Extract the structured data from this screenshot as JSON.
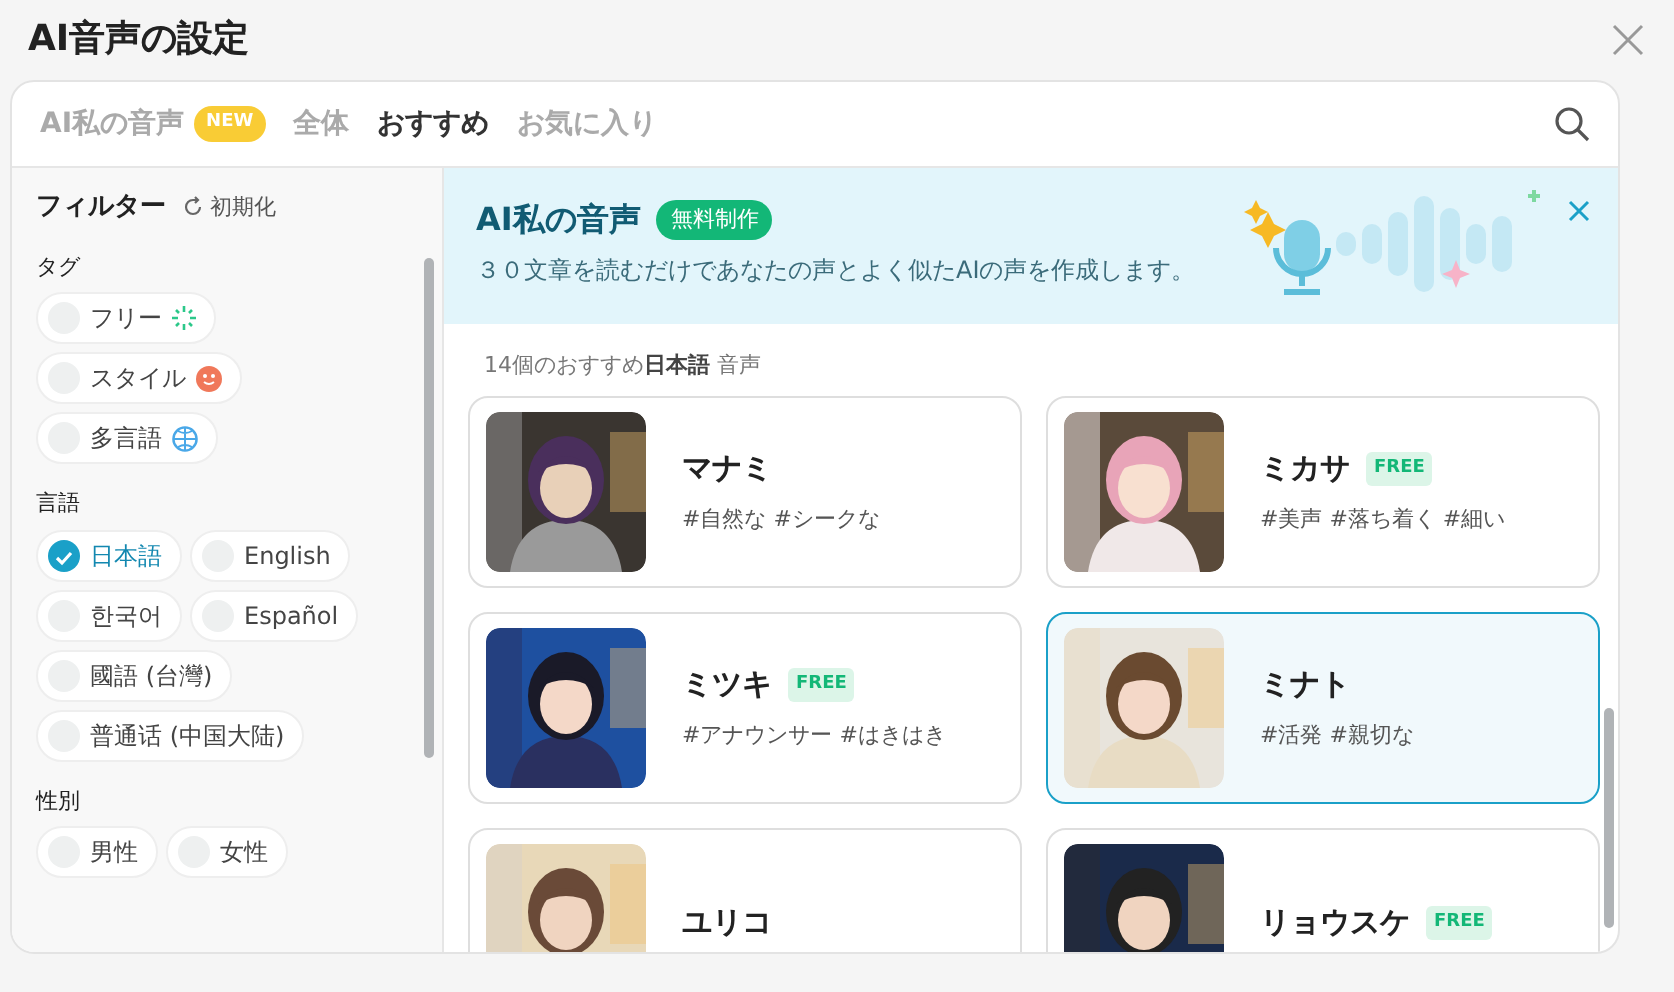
{
  "window": {
    "title": "AI音声の設定"
  },
  "tabs": [
    {
      "label": "AI私の音声",
      "badge": "NEW",
      "selected": false
    },
    {
      "label": "全体",
      "selected": false
    },
    {
      "label": "おすすめ",
      "selected": true
    },
    {
      "label": "お気に入り",
      "selected": false
    }
  ],
  "filter": {
    "title": "フィルター",
    "reset": "初期化",
    "groups": [
      {
        "title": "タグ",
        "items": [
          {
            "label": "フリー",
            "kind": "sparkle",
            "selected": false
          },
          {
            "label": "スタイル",
            "kind": "smile",
            "selected": false
          },
          {
            "label": "多言語",
            "kind": "globe",
            "selected": false
          }
        ]
      },
      {
        "title": "言語",
        "items": [
          {
            "label": "日本語",
            "selected": true
          },
          {
            "label": "English",
            "selected": false
          },
          {
            "label": "한국어",
            "selected": false
          },
          {
            "label": "Español",
            "selected": false
          },
          {
            "label": "國語 (台灣)",
            "selected": false
          },
          {
            "label": "普通话 (中国大陆)",
            "selected": false
          }
        ]
      },
      {
        "title": "性別",
        "items": [
          {
            "label": "男性",
            "selected": false
          },
          {
            "label": "女性",
            "selected": false
          }
        ]
      }
    ]
  },
  "banner": {
    "title": "AI私の音声",
    "badge": "無料制作",
    "text": "３０文章を読むだけであなたの声とよく似たAIの声を作成します。"
  },
  "list_heading": "14個のおすすめ**日本語** 音声",
  "voices": [
    {
      "name": "マナミ",
      "tags": "#自然な #シークな",
      "selected": false
    },
    {
      "name": "ミカサ",
      "badge": "FREE",
      "tags": "#美声 #落ち着く #細い",
      "selected": false
    },
    {
      "name": "ミツキ",
      "badge": "FREE",
      "tags": "#アナウンサー #はきはき",
      "selected": false
    },
    {
      "name": "ミナト",
      "tags": "#活発 #親切な",
      "selected": true
    },
    {
      "name": "ユリコ",
      "selected": false
    },
    {
      "name": "リョウスケ",
      "badge": "FREE",
      "selected": false
    }
  ]
}
